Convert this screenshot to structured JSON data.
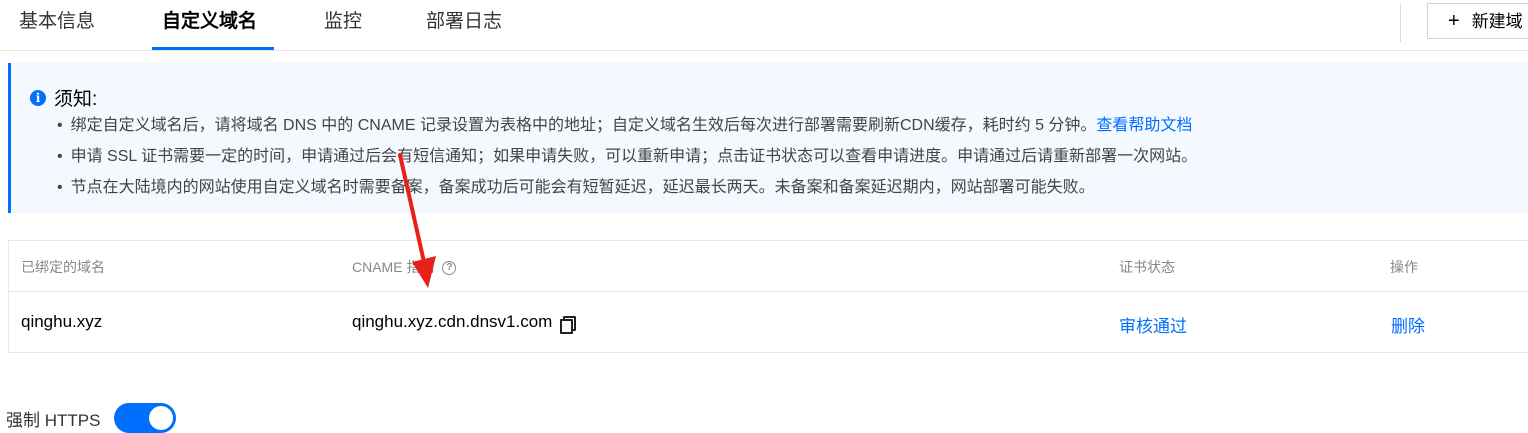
{
  "tabs": [
    {
      "label": "基本信息",
      "active": false
    },
    {
      "label": "自定义域名",
      "active": true
    },
    {
      "label": "监控",
      "active": false
    },
    {
      "label": "部署日志",
      "active": false
    }
  ],
  "new_button": {
    "label": "新建域"
  },
  "notice": {
    "title": "须知:",
    "bullet": "•",
    "line1": "绑定自定义域名后，请将域名 DNS 中的 CNAME 记录设置为表格中的地址；自定义域名生效后每次进行部署需要刷新CDN缓存，耗时约 5 分钟。",
    "line1_link": "查看帮助文档",
    "line2": "申请 SSL 证书需要一定的时间，申请通过后会有短信通知；如果申请失败，可以重新申请；点击证书状态可以查看申请进度。申请通过后请重新部署一次网站。",
    "line3": "节点在大陆境内的网站使用自定义域名时需要备案，备案成功后可能会有短暂延迟，延迟最长两天。未备案和备案延迟期内，网站部署可能失败。"
  },
  "table": {
    "headers": {
      "domain": "已绑定的域名",
      "cname": "CNAME 指向",
      "cert": "证书状态",
      "action": "操作"
    },
    "rows": [
      {
        "domain": "qinghu.xyz",
        "cname": "qinghu.xyz.cdn.dnsv1.com",
        "cert": "审核通过",
        "action": "删除"
      }
    ]
  },
  "https": {
    "label": "强制 HTTPS",
    "enabled": true
  },
  "colors": {
    "accent": "#006eff",
    "annotation_arrow": "#e8201a"
  }
}
